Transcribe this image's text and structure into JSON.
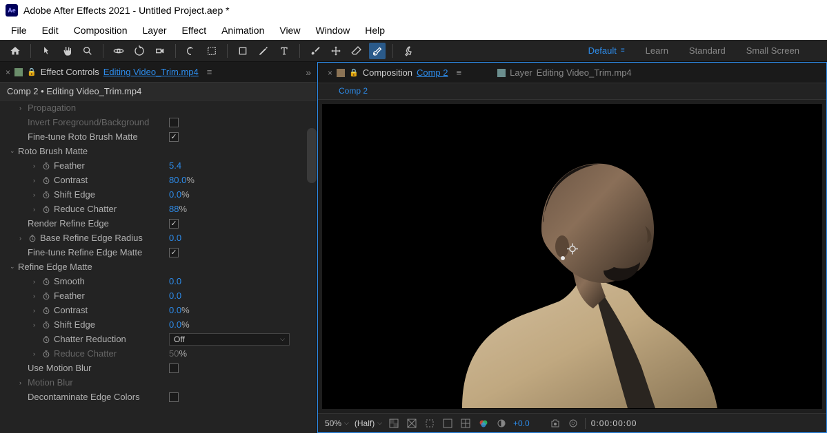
{
  "app": {
    "title": "Adobe After Effects 2021 - Untitled Project.aep *",
    "logo_text": "Ae"
  },
  "menu": [
    "File",
    "Edit",
    "Composition",
    "Layer",
    "Effect",
    "Animation",
    "View",
    "Window",
    "Help"
  ],
  "workspaces": {
    "active": "Default",
    "items": [
      "Default",
      "Learn",
      "Standard",
      "Small Screen"
    ]
  },
  "effect_panel": {
    "tab_label": "Effect Controls",
    "tab_file": "Editing Video_Trim.mp4",
    "breadcrumb": "Comp 2 • Editing Video_Trim.mp4"
  },
  "props": [
    {
      "type": "group",
      "indent": 1,
      "arrow": ">",
      "label": "Propagation",
      "dim": true
    },
    {
      "type": "check",
      "indent": 1,
      "label": "Invert Foreground/Background",
      "checked": false,
      "dim": true
    },
    {
      "type": "check",
      "indent": 1,
      "label": "Fine-tune Roto Brush Matte",
      "checked": true
    },
    {
      "type": "group",
      "indent": 0,
      "arrow": "v",
      "label": "Roto Brush Matte"
    },
    {
      "type": "param",
      "indent": 2,
      "arrow": ">",
      "stopwatch": true,
      "label": "Feather",
      "value": "5.4",
      "unit": ""
    },
    {
      "type": "param",
      "indent": 2,
      "arrow": ">",
      "stopwatch": true,
      "label": "Contrast",
      "value": "80.0",
      "unit": "%"
    },
    {
      "type": "param",
      "indent": 2,
      "arrow": ">",
      "stopwatch": true,
      "label": "Shift Edge",
      "value": "0.0",
      "unit": "%"
    },
    {
      "type": "param",
      "indent": 2,
      "arrow": ">",
      "stopwatch": true,
      "label": "Reduce Chatter",
      "value": "88",
      "unit": "%"
    },
    {
      "type": "check",
      "indent": 1,
      "label": "Render Refine Edge",
      "checked": true
    },
    {
      "type": "param",
      "indent": 1,
      "arrow": ">",
      "stopwatch": true,
      "label": "Base Refine Edge Radius",
      "value": "0.0",
      "unit": ""
    },
    {
      "type": "check",
      "indent": 1,
      "label": "Fine-tune Refine Edge Matte",
      "checked": true
    },
    {
      "type": "group",
      "indent": 0,
      "arrow": "v",
      "label": "Refine Edge Matte"
    },
    {
      "type": "param",
      "indent": 2,
      "arrow": ">",
      "stopwatch": true,
      "label": "Smooth",
      "value": "0.0",
      "unit": ""
    },
    {
      "type": "param",
      "indent": 2,
      "arrow": ">",
      "stopwatch": true,
      "label": "Feather",
      "value": "0.0",
      "unit": ""
    },
    {
      "type": "param",
      "indent": 2,
      "arrow": ">",
      "stopwatch": true,
      "label": "Contrast",
      "value": "0.0",
      "unit": "%"
    },
    {
      "type": "param",
      "indent": 2,
      "arrow": ">",
      "stopwatch": true,
      "label": "Shift Edge",
      "value": "0.0",
      "unit": "%"
    },
    {
      "type": "select",
      "indent": 2,
      "stopwatch": true,
      "label": "Chatter Reduction",
      "value": "Off"
    },
    {
      "type": "param",
      "indent": 2,
      "arrow": ">",
      "stopwatch": true,
      "label": "Reduce Chatter",
      "value": "50",
      "unit": "%",
      "dim": true
    },
    {
      "type": "check",
      "indent": 1,
      "label": "Use Motion Blur",
      "checked": false
    },
    {
      "type": "group",
      "indent": 1,
      "arrow": ">",
      "label": "Motion Blur",
      "dim": true
    },
    {
      "type": "check",
      "indent": 1,
      "label": "Decontaminate Edge Colors",
      "checked": false
    }
  ],
  "comp_panel": {
    "tab_label": "Composition",
    "tab_name": "Comp 2",
    "layer_label": "Layer",
    "layer_file": "Editing Video_Trim.mp4",
    "sub_tab": "Comp 2"
  },
  "viewer_footer": {
    "zoom": "50%",
    "resolution": "(Half)",
    "exposure": "+0.0",
    "time": "0:00:00:00"
  },
  "toolbar_icons": [
    "home",
    "select",
    "hand",
    "zoom",
    "orbit",
    "rotate",
    "unified",
    "undo",
    "snap",
    "region",
    "brush",
    "type",
    "pen",
    "clone",
    "eraser",
    "roto",
    "pin"
  ],
  "viewer_icons": [
    "grid",
    "guides",
    "mask",
    "alpha",
    "channel",
    "color",
    "reset",
    "camera",
    "refresh"
  ]
}
